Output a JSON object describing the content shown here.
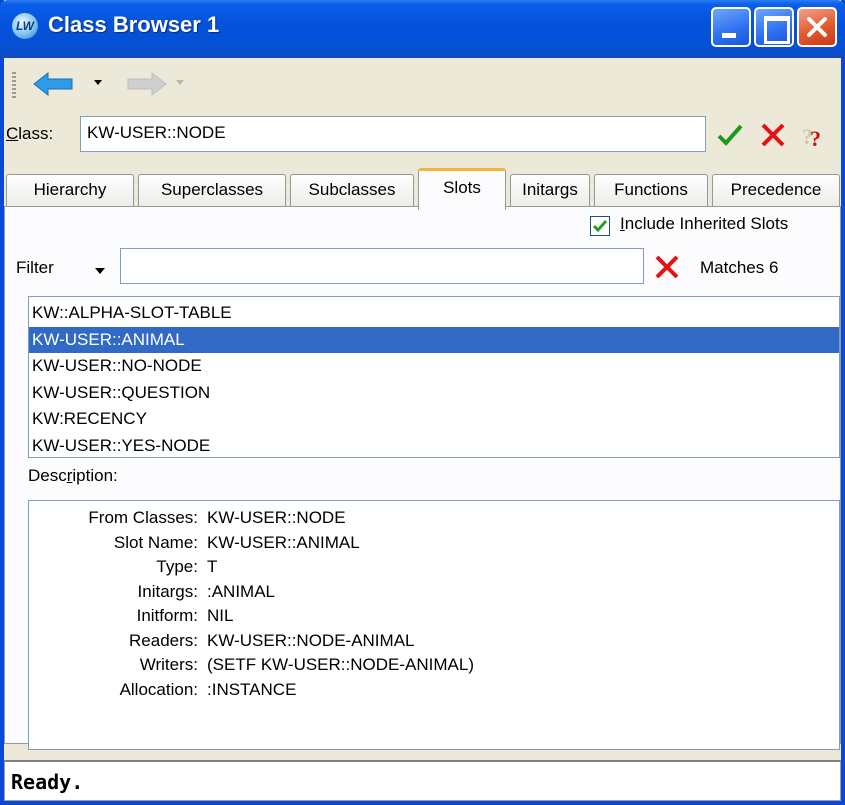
{
  "window": {
    "title": "Class Browser 1",
    "icon_text": "LW"
  },
  "toolbar": {
    "back_icon": "back-arrow-icon",
    "forward_icon": "forward-arrow-icon"
  },
  "class_field": {
    "label_underlined": "C",
    "label_rest": "lass:",
    "value": "KW-USER::NODE"
  },
  "tabs": [
    {
      "label": "Hierarchy",
      "active": false
    },
    {
      "label": "Superclasses",
      "active": false
    },
    {
      "label": "Subclasses",
      "active": false
    },
    {
      "label": "Slots",
      "active": true
    },
    {
      "label": "Initargs",
      "active": false
    },
    {
      "label": "Functions",
      "active": false
    },
    {
      "label": "Precedence",
      "active": false
    }
  ],
  "include_inherited": {
    "checked": true,
    "label_underlined": "I",
    "label_rest": "nclude Inherited Slots"
  },
  "filter": {
    "label": "Filter",
    "value": "",
    "matches": "Matches 6"
  },
  "slots": [
    {
      "name": "KW::ALPHA-SLOT-TABLE",
      "selected": false
    },
    {
      "name": "KW-USER::ANIMAL",
      "selected": true
    },
    {
      "name": "KW-USER::NO-NODE",
      "selected": false
    },
    {
      "name": "KW-USER::QUESTION",
      "selected": false
    },
    {
      "name": "KW:RECENCY",
      "selected": false
    },
    {
      "name": "KW-USER::YES-NODE",
      "selected": false
    }
  ],
  "description": {
    "label_pre": "Desc",
    "label_underlined": "r",
    "label_post": "iption:",
    "rows": [
      {
        "key": "From Classes:",
        "value": "KW-USER::NODE"
      },
      {
        "key": "Slot Name:",
        "value": "KW-USER::ANIMAL"
      },
      {
        "key": "Type:",
        "value": "T"
      },
      {
        "key": "Initargs:",
        "value": ":ANIMAL"
      },
      {
        "key": "Initform:",
        "value": "NIL"
      },
      {
        "key": "Readers:",
        "value": "KW-USER::NODE-ANIMAL"
      },
      {
        "key": "Writers:",
        "value": "(SETF KW-USER::NODE-ANIMAL)"
      },
      {
        "key": "Allocation:",
        "value": ":INSTANCE"
      }
    ]
  },
  "status": "Ready.",
  "colors": {
    "titlebar": "#0453dc",
    "selection": "#316ac5",
    "ok_green": "#1c9a1c",
    "cancel_red": "#e81010",
    "active_tab_accent": "#f8b33a"
  }
}
